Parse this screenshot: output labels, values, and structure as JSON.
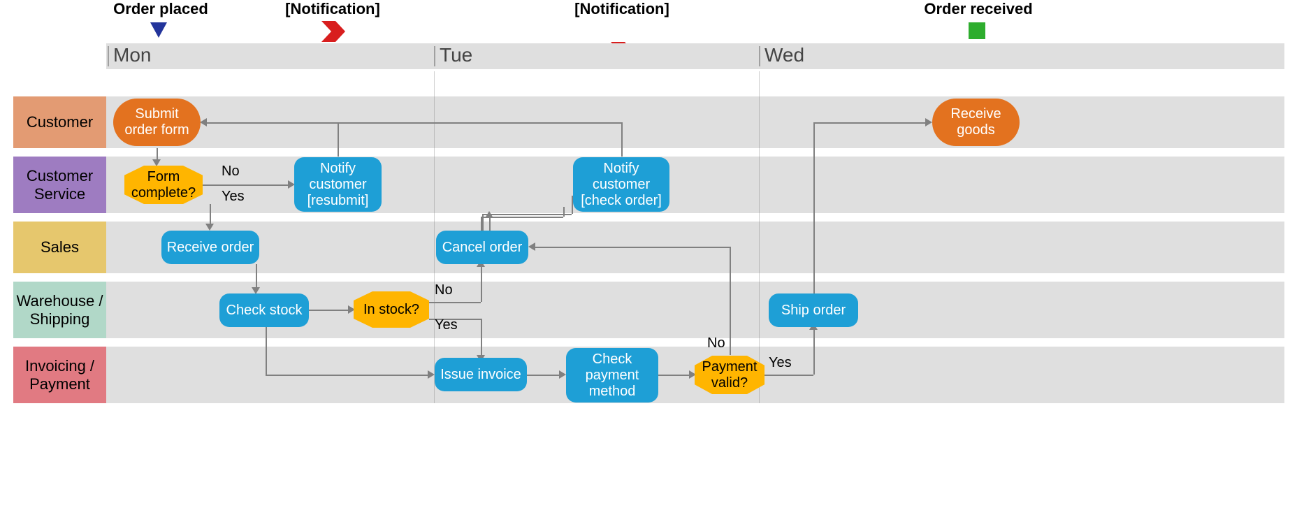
{
  "events": {
    "e1": {
      "label": "Order placed"
    },
    "e2": {
      "label": "[Notification]"
    },
    "e3": {
      "label": "[Notification]"
    },
    "e4": {
      "label": "Order received"
    }
  },
  "timeline": {
    "day1": "Mon",
    "day2": "Tue",
    "day3": "Wed"
  },
  "lanes": {
    "customer": {
      "label": "Customer"
    },
    "service": {
      "label": "Customer\nService"
    },
    "sales": {
      "label": "Sales"
    },
    "warehouse": {
      "label": "Warehouse /\nShipping"
    },
    "payment": {
      "label": "Invoicing /\nPayment"
    }
  },
  "nodes": {
    "submit": "Submit\norder form",
    "receiveGoods": "Receive\ngoods",
    "formComplete": "Form\ncomplete?",
    "notifyResub": "Notify\ncustomer\n[resubmit]",
    "notifyCheck": "Notify\ncustomer\n[check order]",
    "receiveOrder": "Receive order",
    "cancelOrder": "Cancel order",
    "checkStock": "Check stock",
    "inStock": "In stock?",
    "shipOrder": "Ship order",
    "issueInvoice": "Issue invoice",
    "checkPayment": "Check\npayment\nmethod",
    "paymentValid": "Payment\nvalid?"
  },
  "edgeLabels": {
    "no": "No",
    "yes": "Yes"
  }
}
